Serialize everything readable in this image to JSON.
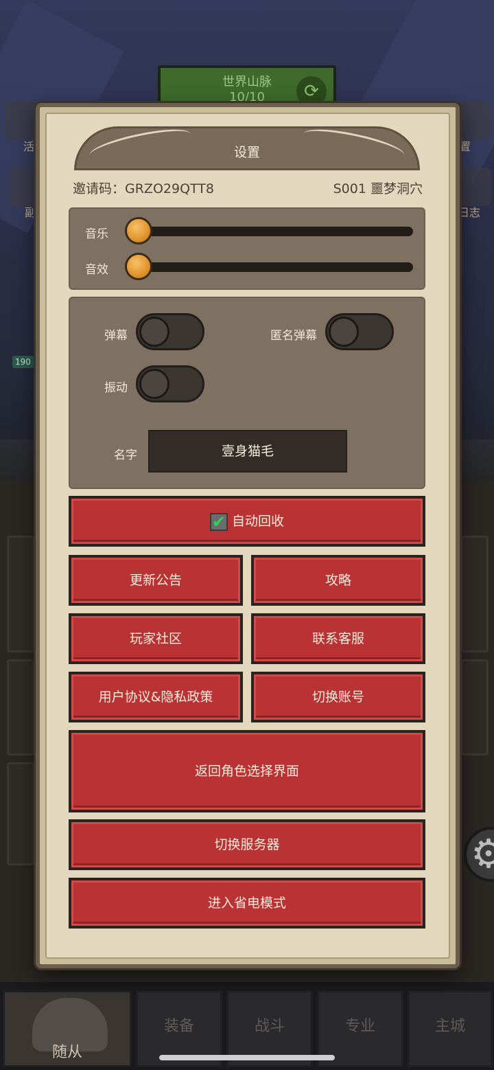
{
  "background": {
    "world_banner": {
      "title": "世界山脉",
      "progress": "10/10"
    },
    "hp_badge": "190",
    "side_labels": {
      "left_1": "活",
      "left_2": "副",
      "right_1": "置",
      "right_2": "日志"
    }
  },
  "dialog": {
    "title": "设置",
    "invite_code": "邀请码：GRZO29QTT8",
    "server": "S001 噩梦洞穴",
    "audio": {
      "music_label": "音乐",
      "music_value": 0,
      "sfx_label": "音效",
      "sfx_value": 0
    },
    "options": {
      "barrage_label": "弹幕",
      "barrage_on": false,
      "anon_barrage_label": "匿名弹幕",
      "anon_barrage_on": false,
      "vibration_label": "振动",
      "vibration_on": false,
      "name_label": "名字",
      "name_value": "壹身猫毛"
    },
    "buttons": {
      "auto_recycle": "自动回收",
      "auto_recycle_checked": true,
      "update_notice": "更新公告",
      "guide": "攻略",
      "community": "玩家社区",
      "contact_service": "联系客服",
      "agreement": "用户协议&隐私政策",
      "switch_account": "切换账号",
      "back_to_role_select": "返回角色选择界面",
      "switch_server": "切换服务器",
      "power_saving": "进入省电模式"
    }
  },
  "bottom_nav": {
    "tabs": [
      "随从",
      "装备",
      "战斗",
      "专业",
      "主城"
    ],
    "active": "随从"
  },
  "colors": {
    "button_red": "#b93234",
    "panel_brown": "#7f7161",
    "parchment": "#e3d8bd",
    "slider_orange": "#e09a36"
  }
}
